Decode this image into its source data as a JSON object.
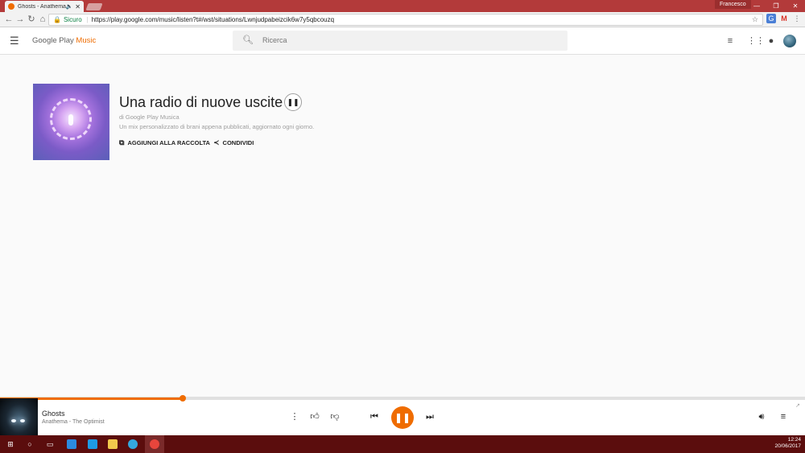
{
  "browser": {
    "tab_title": "Ghosts - Anathema",
    "user_name": "Francesco",
    "security_label": "Sicuro",
    "url": "https://play.google.com/music/listen?t#/wst/situations/Lwnjudpabeizcik6w7y5qbcouzq"
  },
  "app": {
    "logo_prefix": "Google Play ",
    "logo_accent": "Music",
    "search_placeholder": "Ricerca",
    "accent_color": "#ef6c00"
  },
  "station": {
    "title": "Una radio di nuove uscite",
    "byline": "di Google Play Musica",
    "description": "Un mix personalizzato di brani appena pubblicati, aggiornato ogni giorno.",
    "add_label": "AGGIUNGI ALLA RACCOLTA",
    "share_label": "CONDIVIDI"
  },
  "player": {
    "song": "Ghosts",
    "artist_album": "Anathema - The Optimist",
    "progress": 0.227
  },
  "taskbar": {
    "time": "12:24",
    "date": "20/06/2017"
  }
}
